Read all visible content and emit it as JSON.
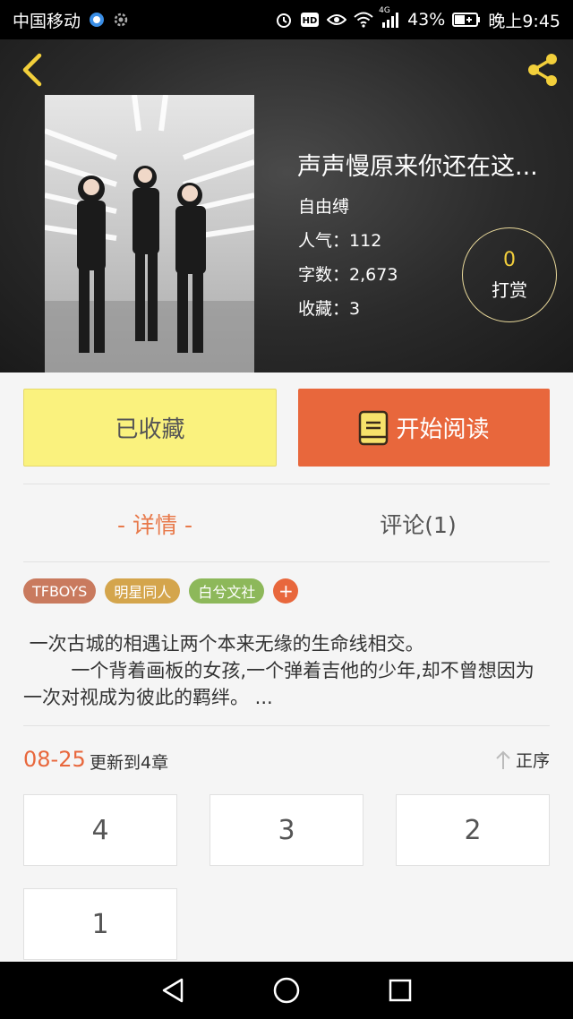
{
  "status_bar": {
    "carrier": "中国移动",
    "network": "4G",
    "battery": "43%",
    "time": "晚上9:45"
  },
  "book": {
    "title": "声声慢原来你还在这...",
    "author": "自由缚",
    "popularity_label": "人气：",
    "popularity": "112",
    "words_label": "字数：",
    "words": "2,673",
    "favorites_label": "收藏：",
    "favorites": "3"
  },
  "reward": {
    "count": "0",
    "label": "打赏"
  },
  "actions": {
    "favorited_label": "已收藏",
    "read_label": "开始阅读"
  },
  "tabs": [
    {
      "label": "- 详情 -"
    },
    {
      "label": "评论(1)"
    }
  ],
  "tags": [
    {
      "label": "TFBOYS",
      "color": "#c97a5e"
    },
    {
      "label": "明星同人",
      "color": "#d4a54c"
    },
    {
      "label": "白兮文社",
      "color": "#8db85a"
    }
  ],
  "tag_add_label": "+",
  "description": {
    "line1": " 一次古城的相遇让两个本来无缘的生命线相交。",
    "line2": "        一个背着画板的女孩,一个弹着吉他的少年,却不曾想因为一次对视成为彼此的羁绊。 ..."
  },
  "update": {
    "date": "08-25",
    "text": "更新到4章",
    "order_label": "正序"
  },
  "chapters": [
    "4",
    "3",
    "2",
    "1"
  ],
  "colors": {
    "accent": "#e8673c",
    "favorite_bg": "#faf27e",
    "reward_gold": "#f3cf3c"
  }
}
